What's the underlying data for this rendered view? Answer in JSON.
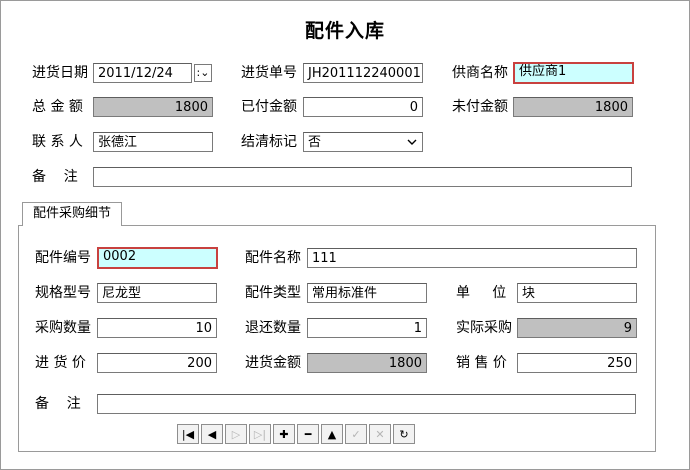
{
  "window": {
    "title": "配件入库"
  },
  "header": {
    "date_label": "进货日期",
    "date_value": "2011/12/24",
    "date_dropdown": ":",
    "order_label": "进货单号",
    "order_value": "JH201112240001",
    "supplier_label": "供商名称",
    "supplier_value": "供应商1",
    "total_label": "总 金 额",
    "total_value": "1800",
    "paid_label": "已付金额",
    "paid_value": "0",
    "unpaid_label": "未付金额",
    "unpaid_value": "1800",
    "contact_label": "联 系 人",
    "contact_value": "张德江",
    "settled_label": "结清标记",
    "settled_value": "否",
    "remark_label": "备    注",
    "remark_value": ""
  },
  "detail": {
    "tab_label": "配件采购细节",
    "code_label": "配件编号",
    "code_value": "0002",
    "name_label": "配件名称",
    "name_value": "111",
    "spec_label": "规格型号",
    "spec_value": "尼龙型",
    "type_label": "配件类型",
    "type_value": "常用标准件",
    "unit_label": "单     位",
    "unit_value": "块",
    "qty_label": "采购数量",
    "qty_value": "10",
    "return_label": "退还数量",
    "return_value": "1",
    "actual_label": "实际采购",
    "actual_value": "9",
    "price_label": "进 货 价",
    "price_value": "200",
    "amount_label": "进货金额",
    "amount_value": "1800",
    "sale_label": "销 售 价",
    "sale_value": "250",
    "remark_label": "备    注",
    "remark_value": ""
  },
  "navigator": {
    "buttons": [
      {
        "name": "first",
        "glyph": "|◀",
        "enabled": true
      },
      {
        "name": "prior",
        "glyph": "◀",
        "enabled": true
      },
      {
        "name": "next",
        "glyph": "▷",
        "enabled": false
      },
      {
        "name": "last",
        "glyph": "▷|",
        "enabled": false
      },
      {
        "name": "insert",
        "glyph": "✚",
        "enabled": true
      },
      {
        "name": "delete",
        "glyph": "━",
        "enabled": true
      },
      {
        "name": "edit",
        "glyph": "▲",
        "enabled": true
      },
      {
        "name": "post",
        "glyph": "✓",
        "enabled": false
      },
      {
        "name": "cancel",
        "glyph": "✕",
        "enabled": false
      },
      {
        "name": "refresh",
        "glyph": "↻",
        "enabled": true
      }
    ]
  },
  "colors": {
    "readonly": "#c0c0c0",
    "required_bg": "#ccffff",
    "required_border": "#c8413f"
  }
}
